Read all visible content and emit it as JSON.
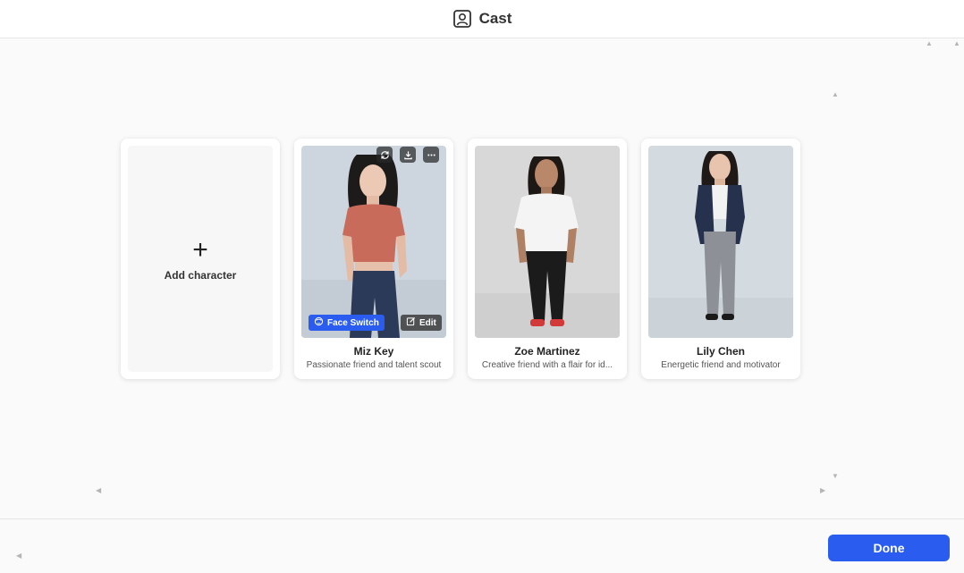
{
  "header": {
    "title": "Cast",
    "icon": "portrait-icon"
  },
  "add_card": {
    "label": "Add character",
    "icon": "plus-icon"
  },
  "characters": [
    {
      "name": "Miz Key",
      "description": "Passionate friend and talent scout",
      "face_switch_label": "Face Switch",
      "edit_label": "Edit"
    },
    {
      "name": "Zoe Martinez",
      "description": "Creative friend with a flair for id..."
    },
    {
      "name": "Lily Chen",
      "description": "Energetic friend and motivator"
    }
  ],
  "footer": {
    "done_label": "Done"
  },
  "colors": {
    "accent": "#2b5cf0",
    "background": "#fafafa"
  }
}
